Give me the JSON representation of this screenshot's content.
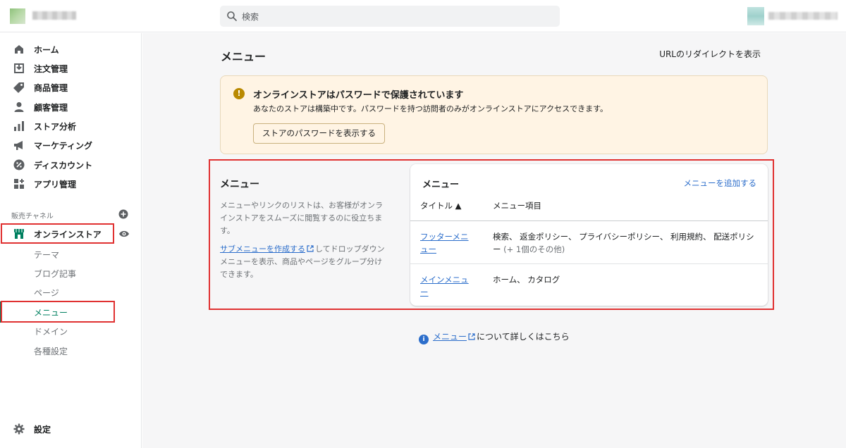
{
  "header": {
    "search_placeholder": "検索"
  },
  "sidebar": {
    "items": [
      {
        "label": "ホーム",
        "icon": "home-icon"
      },
      {
        "label": "注文管理",
        "icon": "orders-icon"
      },
      {
        "label": "商品管理",
        "icon": "tag-icon"
      },
      {
        "label": "顧客管理",
        "icon": "person-icon"
      },
      {
        "label": "ストア分析",
        "icon": "analytics-icon"
      },
      {
        "label": "マーケティング",
        "icon": "megaphone-icon"
      },
      {
        "label": "ディスカウント",
        "icon": "discount-icon"
      },
      {
        "label": "アプリ管理",
        "icon": "apps-icon"
      }
    ],
    "sales_channel_title": "販売チャネル",
    "online_store": "オンラインストア",
    "sub_items": [
      "テーマ",
      "ブログ記事",
      "ページ",
      "メニュー",
      "ドメイン",
      "各種設定"
    ],
    "active_sub_item": "メニュー",
    "settings": "設定"
  },
  "main": {
    "title": "メニュー",
    "redirect_link": "URLのリダイレクトを表示",
    "banner": {
      "title": "オンラインストアはパスワードで保護されています",
      "body": "あなたのストアは構築中です。パスワードを持つ訪問者のみがオンラインストアにアクセスできます。",
      "button": "ストアのパスワードを表示する"
    },
    "description": {
      "title": "メニュー",
      "text": "メニューやリンクのリストは、お客様がオンラインストアをスムーズに閲覧するのに役立ちます。",
      "link": "サブメニューを作成する",
      "text2": "してドロップダウンメニューを表示、商品やページをグループ分けできます。"
    },
    "card": {
      "title": "メニュー",
      "add_link": "メニューを追加する",
      "col_title": "タイトル ▲",
      "col_items": "メニュー項目",
      "rows": [
        {
          "title": "フッターメニュー",
          "items": "検索、 返金ポリシー、 プライバシーポリシー、 利用規約、 配送ポリシー",
          "more": "(+ 1個のその他)"
        },
        {
          "title": "メインメニュー",
          "items": "ホーム、 カタログ",
          "more": ""
        }
      ]
    },
    "learn_more": {
      "link": "メニュー",
      "text": "について詳しくはこちら"
    }
  },
  "colors": {
    "accent_green": "#008060",
    "link_blue": "#2c6ecb",
    "highlight_red": "#e03131",
    "banner_bg": "#fff4e4"
  }
}
